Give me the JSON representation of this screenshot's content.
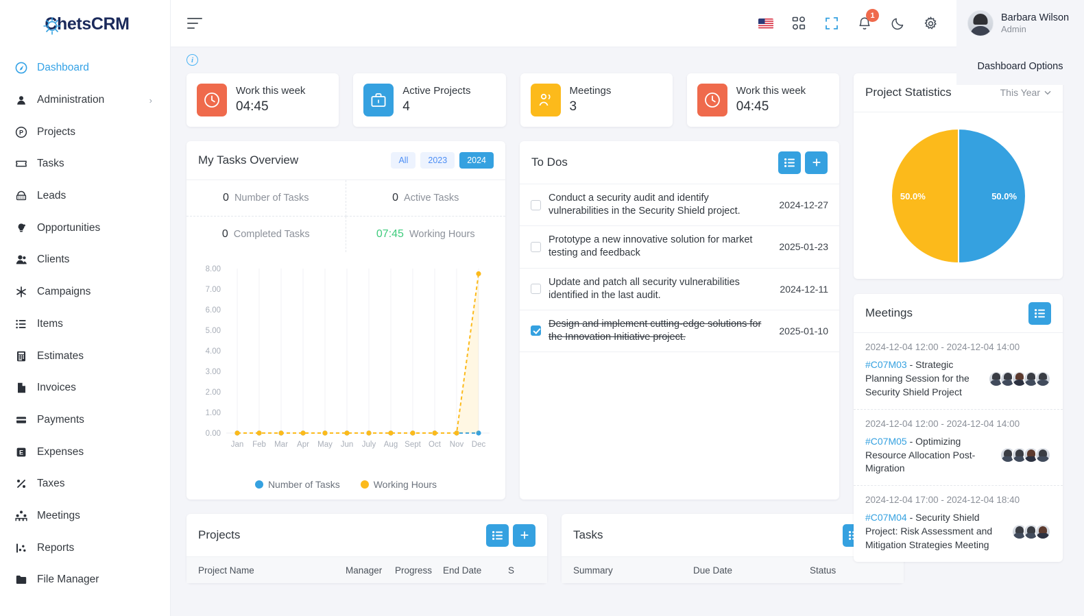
{
  "brand": {
    "name": "ChetsCRM",
    "accent": "#35a1e0",
    "logo_icon": "chets-logo-icon"
  },
  "sidebar": {
    "items": [
      {
        "label": "Dashboard",
        "icon": "gauge-icon",
        "active": true,
        "caret": false
      },
      {
        "label": "Administration",
        "icon": "user-circle-icon",
        "active": false,
        "caret": true
      },
      {
        "label": "Projects",
        "icon": "p-circle-icon",
        "active": false,
        "caret": false
      },
      {
        "label": "Tasks",
        "icon": "ticket-icon",
        "active": false,
        "caret": false
      },
      {
        "label": "Leads",
        "icon": "leads-icon",
        "active": false,
        "caret": false
      },
      {
        "label": "Opportunities",
        "icon": "bulb-icon",
        "active": false,
        "caret": false
      },
      {
        "label": "Clients",
        "icon": "users-icon",
        "active": false,
        "caret": false
      },
      {
        "label": "Campaigns",
        "icon": "asterisk-icon",
        "active": false,
        "caret": false
      },
      {
        "label": "Items",
        "icon": "list-icon",
        "active": false,
        "caret": false
      },
      {
        "label": "Estimates",
        "icon": "calculator-icon",
        "active": false,
        "caret": false
      },
      {
        "label": "Invoices",
        "icon": "file-icon",
        "active": false,
        "caret": false
      },
      {
        "label": "Payments",
        "icon": "card-icon",
        "active": false,
        "caret": false
      },
      {
        "label": "Expenses",
        "icon": "e-square-icon",
        "active": false,
        "caret": false
      },
      {
        "label": "Taxes",
        "icon": "percent-icon",
        "active": false,
        "caret": false
      },
      {
        "label": "Meetings",
        "icon": "group-icon",
        "active": false,
        "caret": false
      },
      {
        "label": "Reports",
        "icon": "chart-icon",
        "active": false,
        "caret": false
      },
      {
        "label": "File Manager",
        "icon": "folder-icon",
        "active": false,
        "caret": false
      }
    ]
  },
  "topbar": {
    "menu_toggle": "hamburger-icon",
    "icons": [
      {
        "name": "language-flag-us"
      },
      {
        "name": "apps-grid-icon"
      },
      {
        "name": "fullscreen-icon"
      },
      {
        "name": "notification-bell-icon",
        "badge": "1"
      },
      {
        "name": "dark-mode-moon-icon"
      },
      {
        "name": "settings-gear-icon"
      }
    ],
    "user": {
      "name": "Barbara Wilson",
      "role": "Admin"
    },
    "dashboard_options": "Dashboard Options",
    "info_tooltip": "i"
  },
  "stats": [
    {
      "title": "Work this week",
      "value": "04:45",
      "icon": "clock-icon",
      "color": "#ef6a4c"
    },
    {
      "title": "Active Projects",
      "value": "4",
      "icon": "briefcase-icon",
      "color": "#35a1e0"
    },
    {
      "title": "Meetings",
      "value": "3",
      "icon": "people-icon",
      "color": "#fcba1b"
    },
    {
      "title": "Work this week",
      "value": "04:45",
      "icon": "clock-icon",
      "color": "#ef6a4c"
    }
  ],
  "tasks_overview": {
    "title": "My Tasks Overview",
    "year_tabs": [
      {
        "label": "All",
        "active": false
      },
      {
        "label": "2023",
        "active": false
      },
      {
        "label": "2024",
        "active": true
      }
    ],
    "cells": [
      {
        "value": "0",
        "label": "Number of Tasks",
        "green": false
      },
      {
        "value": "0",
        "label": "Active Tasks",
        "green": false
      },
      {
        "value": "0",
        "label": "Completed Tasks",
        "green": false
      },
      {
        "value": "07:45",
        "label": "Working Hours",
        "green": true
      }
    ]
  },
  "chart_data": {
    "type": "line",
    "title": "My Tasks Overview",
    "xlabel": "",
    "ylabel": "",
    "grid": true,
    "legend_position": "bottom",
    "categories": [
      "Jan",
      "Feb",
      "Mar",
      "Apr",
      "May",
      "Jun",
      "July",
      "Aug",
      "Sept",
      "Oct",
      "Nov",
      "Dec"
    ],
    "ylim": [
      0,
      8
    ],
    "yticks": [
      "0.00",
      "1.00",
      "2.00",
      "3.00",
      "4.00",
      "5.00",
      "6.00",
      "7.00",
      "8.00"
    ],
    "series": [
      {
        "name": "Number of Tasks",
        "color": "#35a1e0",
        "values": [
          0,
          0,
          0,
          0,
          0,
          0,
          0,
          0,
          0,
          0,
          0,
          0
        ]
      },
      {
        "name": "Working Hours",
        "color": "#fcba1b",
        "values": [
          0,
          0,
          0,
          0,
          0,
          0,
          0,
          0,
          0,
          0,
          0,
          7.75
        ]
      }
    ]
  },
  "todos": {
    "title": "To Dos",
    "buttons": [
      {
        "name": "todo-list-view-button",
        "icon": "list-icon"
      },
      {
        "name": "todo-add-button",
        "icon": "plus-icon"
      }
    ],
    "items": [
      {
        "text": "Conduct a security audit and identify vulnerabilities in the Security Shield project.",
        "date": "2024-12-27",
        "checked": false
      },
      {
        "text": "Prototype a new innovative solution for market testing and feedback",
        "date": "2025-01-23",
        "checked": false
      },
      {
        "text": "Update and patch all security vulnerabilities identified in the last audit.",
        "date": "2024-12-11",
        "checked": false
      },
      {
        "text": "Design and implement cutting-edge solutions for the Innovation Initiative project.",
        "date": "2025-01-10",
        "checked": true
      }
    ]
  },
  "project_statistics": {
    "title": "Project Statistics",
    "filter": "This Year",
    "pie": {
      "type": "pie",
      "slices": [
        {
          "label": "50.0%",
          "value": 50,
          "color": "#35a1e0"
        },
        {
          "label": "50.0%",
          "value": 50,
          "color": "#fcba1b"
        }
      ]
    }
  },
  "meetings_panel": {
    "title": "Meetings",
    "button_icon": "list-icon",
    "items": [
      {
        "time": "2024-12-04 12:00 - 2024-12-04 14:00",
        "code": "#C07M03",
        "desc": " - Strategic Planning Session for the Security Shield Project",
        "avatars": 5
      },
      {
        "time": "2024-12-04 12:00 - 2024-12-04 14:00",
        "code": "#C07M05",
        "desc": " - Optimizing Resource Allocation Post-Migration",
        "avatars": 4
      },
      {
        "time": "2024-12-04 17:00 - 2024-12-04 18:40",
        "code": "#C07M04",
        "desc": " - Security Shield Project: Risk Assessment and Mitigation Strategies Meeting",
        "avatars": 3
      }
    ]
  },
  "projects_table": {
    "title": "Projects",
    "buttons": [
      {
        "name": "projects-list-view-button",
        "icon": "list-icon"
      },
      {
        "name": "projects-add-button",
        "icon": "plus-icon"
      }
    ],
    "columns": [
      "Project Name",
      "Manager",
      "Progress",
      "End Date",
      "S"
    ]
  },
  "tasks_table": {
    "title": "Tasks",
    "buttons": [
      {
        "name": "tasks-list-view-button",
        "icon": "list-icon"
      },
      {
        "name": "tasks-add-button",
        "icon": "plus-icon"
      }
    ],
    "columns": [
      "Summary",
      "Due Date",
      "Status"
    ]
  }
}
